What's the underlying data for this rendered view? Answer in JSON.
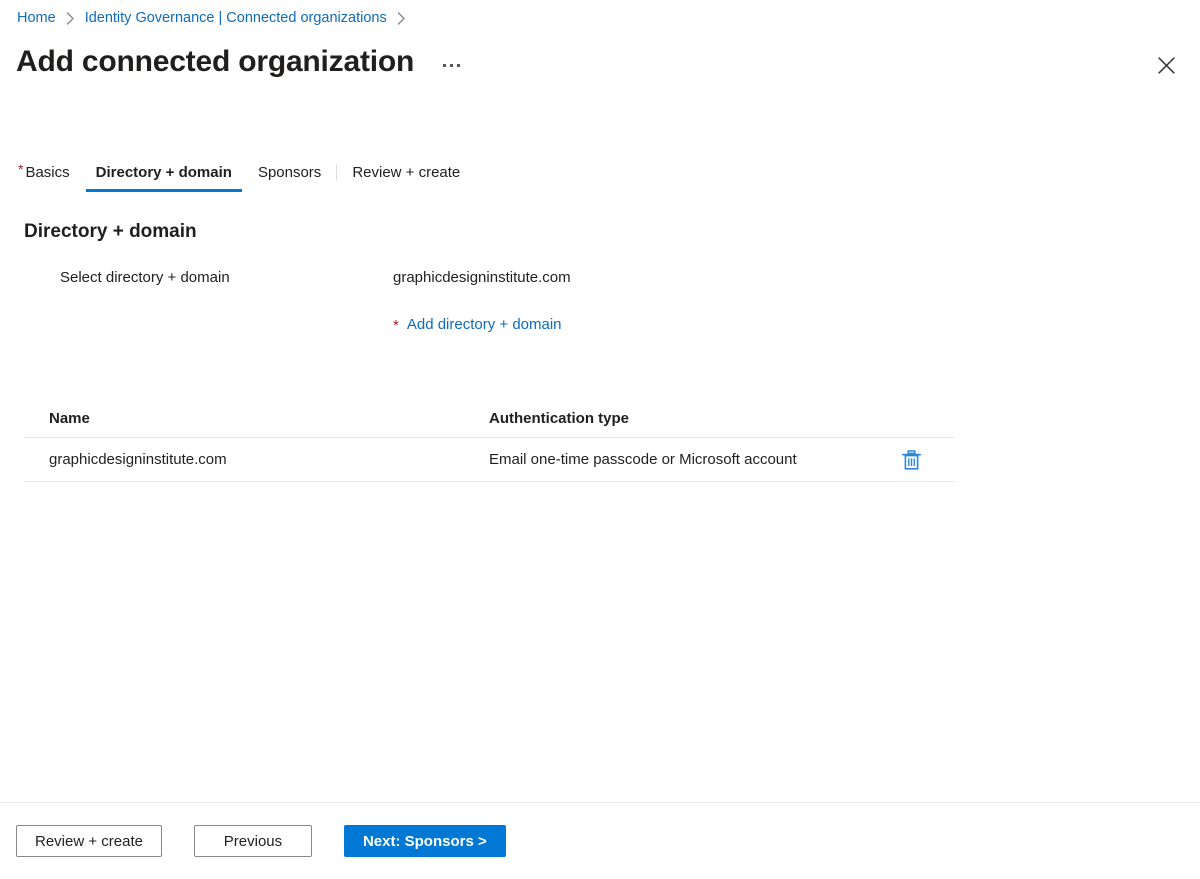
{
  "breadcrumb": {
    "items": [
      {
        "label": "Home"
      },
      {
        "label": "Identity Governance | Connected organizations"
      }
    ],
    "separator_icon": "chevron-right-icon"
  },
  "header": {
    "title": "Add connected organization",
    "more_icon": "ellipsis-icon",
    "close_icon": "close-icon"
  },
  "tabs": [
    {
      "label": "Basics",
      "required": true,
      "active": false
    },
    {
      "label": "Directory + domain",
      "required": false,
      "active": true
    },
    {
      "label": "Sponsors",
      "required": false,
      "active": false
    },
    {
      "label": "Review + create",
      "required": false,
      "active": false
    }
  ],
  "section": {
    "title": "Directory + domain",
    "field": {
      "label": "Select directory + domain",
      "value": "graphicdesigninstitute.com"
    },
    "add_link": {
      "required_marker": "*",
      "label": "Add directory + domain"
    }
  },
  "table": {
    "columns": {
      "name": "Name",
      "auth_type": "Authentication type"
    },
    "rows": [
      {
        "name": "graphicdesigninstitute.com",
        "auth_type": "Email one-time passcode or Microsoft account",
        "delete_icon": "trash-icon"
      }
    ]
  },
  "footer": {
    "review_create_label": "Review + create",
    "previous_label": "Previous",
    "next_label": "Next: Sponsors >"
  },
  "colors": {
    "link": "#0f6cbd",
    "accent": "#0078d4",
    "required": "#a4262c",
    "text": "#201f1e",
    "border": "#e9e9e9"
  }
}
